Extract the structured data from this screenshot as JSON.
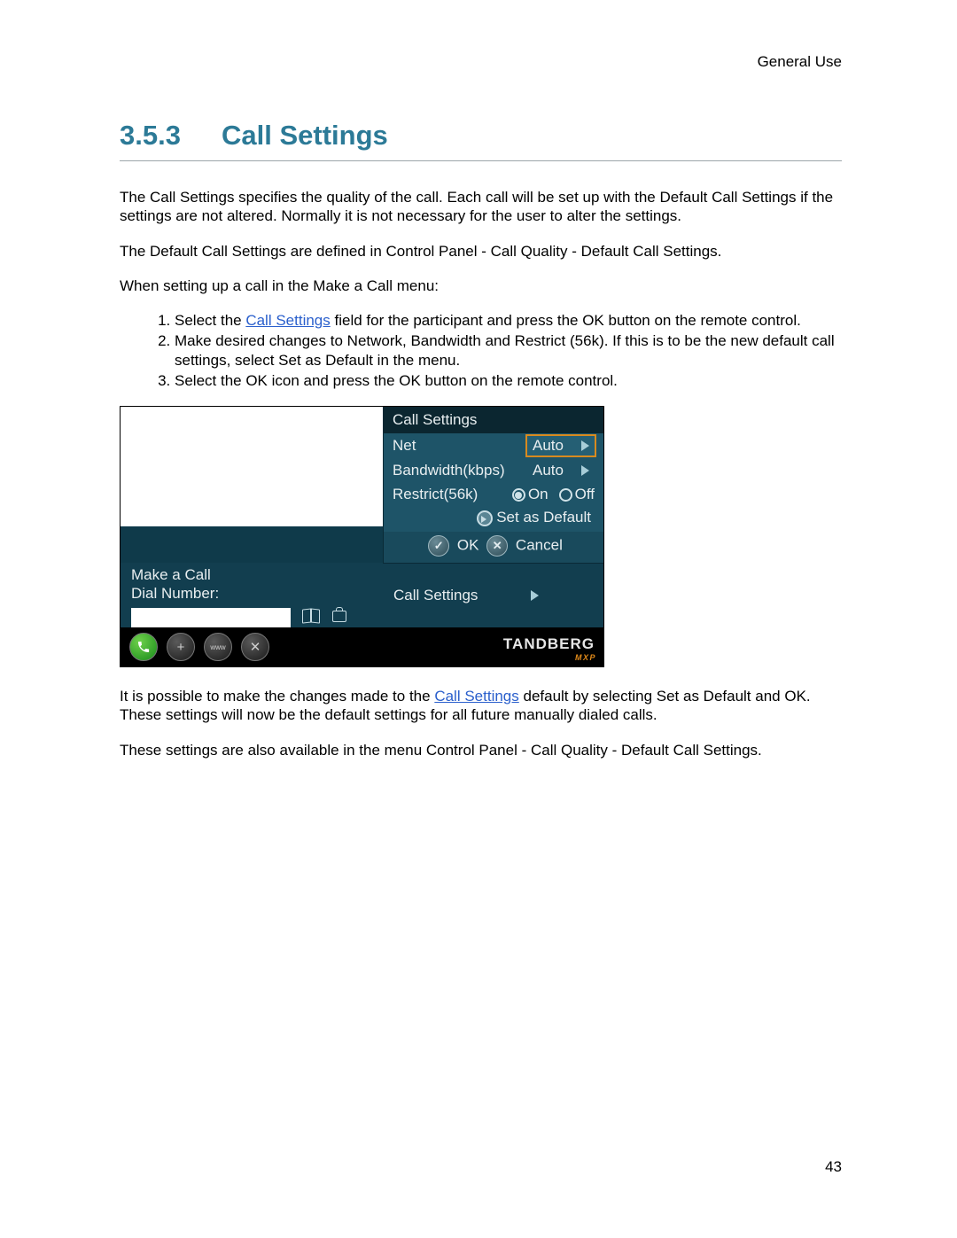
{
  "header": {
    "section_label": "General Use"
  },
  "heading": {
    "number": "3.5.3",
    "title": "Call Settings"
  },
  "paragraphs": {
    "p1": "The Call Settings specifies the quality of the call. Each call will be set up with the Default Call Settings if the settings are not altered. Normally it is not necessary for the user to alter the settings.",
    "p2": "The Default Call Settings are defined in Control Panel - Call Quality - Default Call Settings.",
    "p3": "When setting up a call in the Make a Call menu:",
    "p4_pre": "It is possible to make the changes made to the ",
    "p4_link": "Call Settings",
    "p4_post": " default by selecting Set as Default and OK. These settings will now be the default settings for all future manually dialed calls.",
    "p5": "These settings are also available in the menu Control Panel - Call Quality - Default Call Settings."
  },
  "list": {
    "i1_pre": "Select the ",
    "i1_link": "Call Settings",
    "i1_post": " field for the participant and press the OK button on the remote control.",
    "i2": "Make desired changes to Network, Bandwidth and Restrict (56k). If this is to be the new default call settings, select Set as Default in the menu.",
    "i3": "Select the OK icon and press the OK button on the remote control."
  },
  "ui": {
    "popup_title": "Call Settings",
    "rows": {
      "net_label": "Net",
      "net_value": "Auto",
      "bw_label": "Bandwidth(kbps)",
      "bw_value": "Auto",
      "restrict_label": "Restrict(56k)",
      "restrict_on": "On",
      "restrict_off": "Off"
    },
    "set_default": "Set as Default",
    "ok": "OK",
    "cancel": "Cancel",
    "make_a_call": "Make a Call",
    "dial_number": "Dial Number:",
    "call_settings_row": "Call Settings",
    "brand": "TANDBERG",
    "brand_sub": "MXP"
  },
  "footer": {
    "page_number": "43"
  }
}
